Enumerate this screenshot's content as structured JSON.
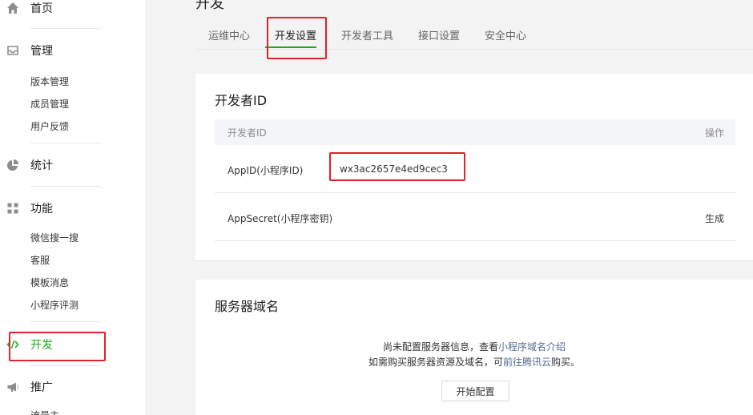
{
  "sidebar": {
    "home": "首页",
    "manage": {
      "label": "管理",
      "items": [
        "版本管理",
        "成员管理",
        "用户反馈"
      ]
    },
    "stats": "统计",
    "features": {
      "label": "功能",
      "items": [
        "微信搜一搜",
        "客服",
        "模板消息",
        "小程序评测"
      ]
    },
    "develop": "开发",
    "promote": "推广",
    "more_partial": "流量主"
  },
  "page": {
    "title": "开发"
  },
  "tabs": [
    {
      "label": "运维中心"
    },
    {
      "label": "开发设置",
      "active": true
    },
    {
      "label": "开发者工具"
    },
    {
      "label": "接口设置"
    },
    {
      "label": "安全中心"
    }
  ],
  "developer_id": {
    "title": "开发者ID",
    "columns": [
      "开发者ID",
      "操作"
    ],
    "rows": [
      {
        "name": "AppID(小程序ID)",
        "value": "wx3ac2657e4ed9cec3",
        "action": ""
      },
      {
        "name": "AppSecret(小程序密钥)",
        "value": "",
        "action": "生成"
      }
    ]
  },
  "server_domain": {
    "title": "服务器域名",
    "line1_text": "尚未配置服务器信息，查看",
    "line1_link": "小程序域名介绍",
    "line2_text": "如需购买服务器资源及域名，可",
    "line2_link": "前往腾讯云",
    "line2_suffix": "购买。",
    "button": "开始配置"
  },
  "colors": {
    "accent": "#1aad19",
    "link": "#576b95",
    "highlight": "#e0222a"
  }
}
